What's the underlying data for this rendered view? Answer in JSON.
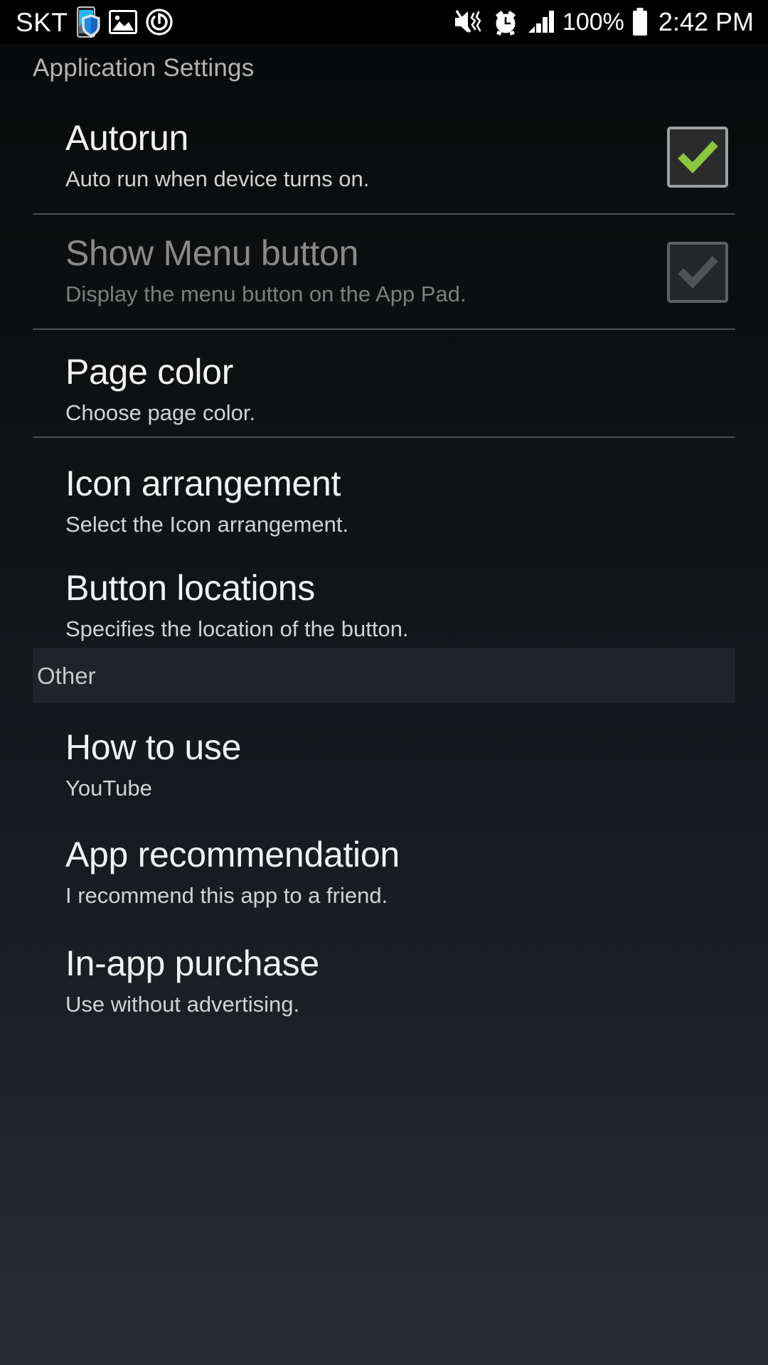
{
  "statusbar": {
    "carrier": "SKT",
    "left_icons": [
      {
        "name": "phone-security-shield-icon"
      },
      {
        "name": "gallery-image-icon"
      },
      {
        "name": "power-sync-icon"
      }
    ],
    "right_icons": [
      {
        "name": "sound-mute-vibrate-icon"
      },
      {
        "name": "alarm-clock-icon"
      },
      {
        "name": "signal-bars-icon"
      }
    ],
    "battery_percent": "100%",
    "battery_icon": "battery-full-icon",
    "time": "2:42 PM"
  },
  "header": {
    "title": "Application Settings"
  },
  "settings": {
    "items": [
      {
        "title": "Autorun",
        "subtitle": "Auto run when device turns on.",
        "widget": "checkbox",
        "checked": true,
        "enabled": true,
        "check_color": "#8cc63f"
      },
      {
        "title": "Show Menu button",
        "subtitle": "Display the menu button on the App Pad.",
        "widget": "checkbox",
        "checked": true,
        "enabled": false,
        "check_color": "#4f5356"
      },
      {
        "title": "Page color",
        "subtitle": "Choose page color.",
        "widget": "none",
        "enabled": true
      },
      {
        "title": "Icon arrangement",
        "subtitle": "Select the Icon arrangement.",
        "widget": "none",
        "enabled": true
      },
      {
        "title": "Button locations",
        "subtitle": "Specifies the location of the button.",
        "widget": "none",
        "enabled": true
      }
    ]
  },
  "other_section": {
    "header": "Other",
    "items": [
      {
        "title": "How to use",
        "subtitle": "YouTube"
      },
      {
        "title": "App recommendation",
        "subtitle": "I recommend this app to a friend."
      },
      {
        "title": "In-app purchase",
        "subtitle": "Use without advertising."
      }
    ]
  },
  "colors": {
    "accent_check": "#8cc63f",
    "background_top": "#08090a",
    "background_bottom": "#272c32",
    "title_text": "#f2f2f2",
    "subtitle_text": "#d2d2d2",
    "disabled_text": "#8a8a8a"
  }
}
